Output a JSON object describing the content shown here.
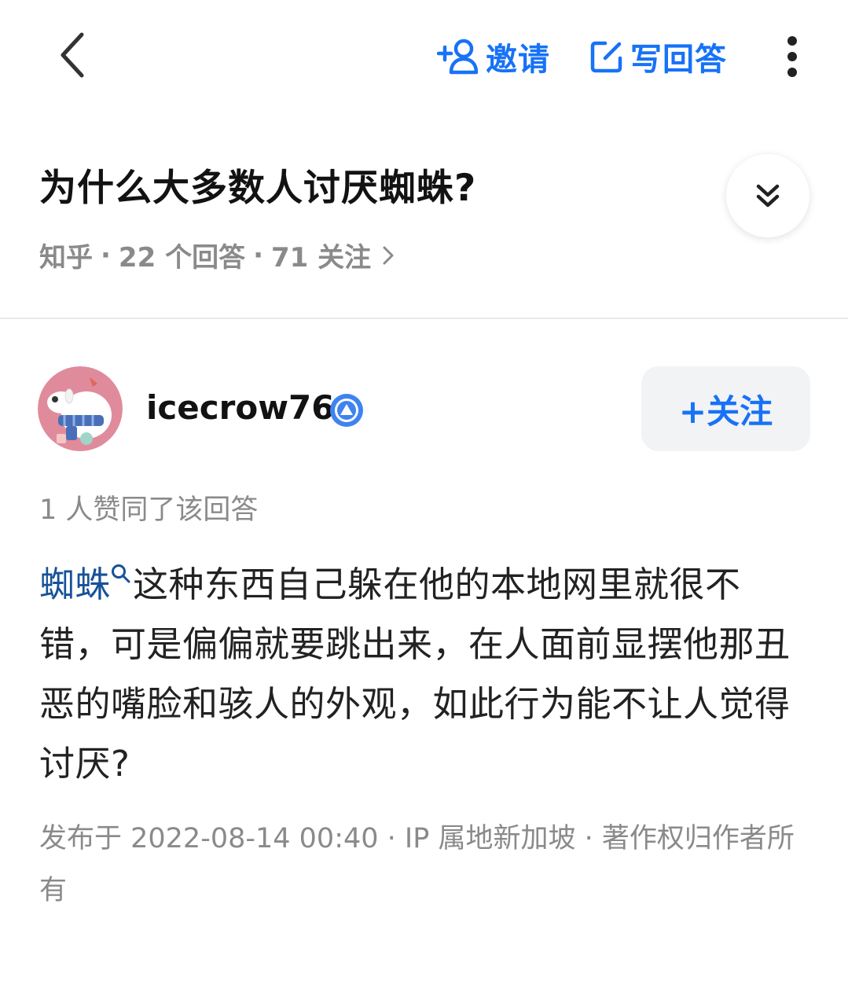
{
  "topbar": {
    "invite_label": "邀请",
    "write_label": "写回答"
  },
  "question": {
    "title": "为什么大多数人讨厌蜘蛛?",
    "source": "知乎",
    "answers": "22 个回答",
    "followers": "71 关注",
    "separator": "·"
  },
  "author": {
    "name": "icecrow76",
    "follow_label": "+关注"
  },
  "answer": {
    "upvote_text": "1 人赞同了该回答",
    "keyword": "蜘蛛",
    "body": "这种东西自己躲在他的本地网里就很不错，可是偏偏就要跳出来，在人面前显摆他那丑恶的嘴脸和骇人的外观，如此行为能不让人觉得讨厌?",
    "footer": "发布于 2022-08-14 00:40 · IP 属地新加坡 · 著作权归作者所有"
  },
  "colors": {
    "accent": "#1772f6",
    "keyword": "#175199",
    "meta": "#8a8a8a"
  },
  "icons": [
    "back-icon",
    "add-user-icon",
    "edit-icon",
    "more-icon",
    "expand-down-icon",
    "chevron-right-icon",
    "verified-badge-icon",
    "search-icon"
  ]
}
